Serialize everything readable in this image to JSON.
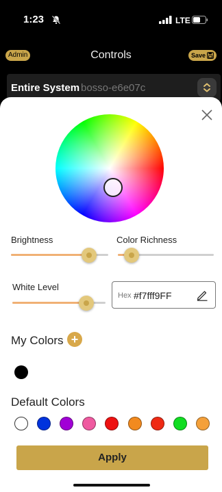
{
  "status": {
    "time": "1:23",
    "network": "LTE"
  },
  "header": {
    "admin_label": "Admin",
    "title": "Controls",
    "save_label": "Save"
  },
  "system": {
    "name": "Entire System",
    "id": "bosso-e6e07c"
  },
  "picker": {
    "brightness_label": "Brightness",
    "brightness_value": 0.86,
    "richness_label": "Color Richness",
    "richness_value": 0.08,
    "white_label": "White Level",
    "white_value": 0.85,
    "hex_label": "Hex",
    "hex_value": "#f7fff9FF"
  },
  "my_colors": {
    "title": "My Colors",
    "add_symbol": "+",
    "swatches": [
      "#000000"
    ]
  },
  "default_colors": {
    "title": "Default Colors",
    "swatches": [
      "#ffffff",
      "#0033dd",
      "#a100d6",
      "#ef5aa0",
      "#ee1111",
      "#f28a1f",
      "#ef2a14",
      "#11dd22",
      "#f4a03a"
    ]
  },
  "apply_label": "Apply"
}
